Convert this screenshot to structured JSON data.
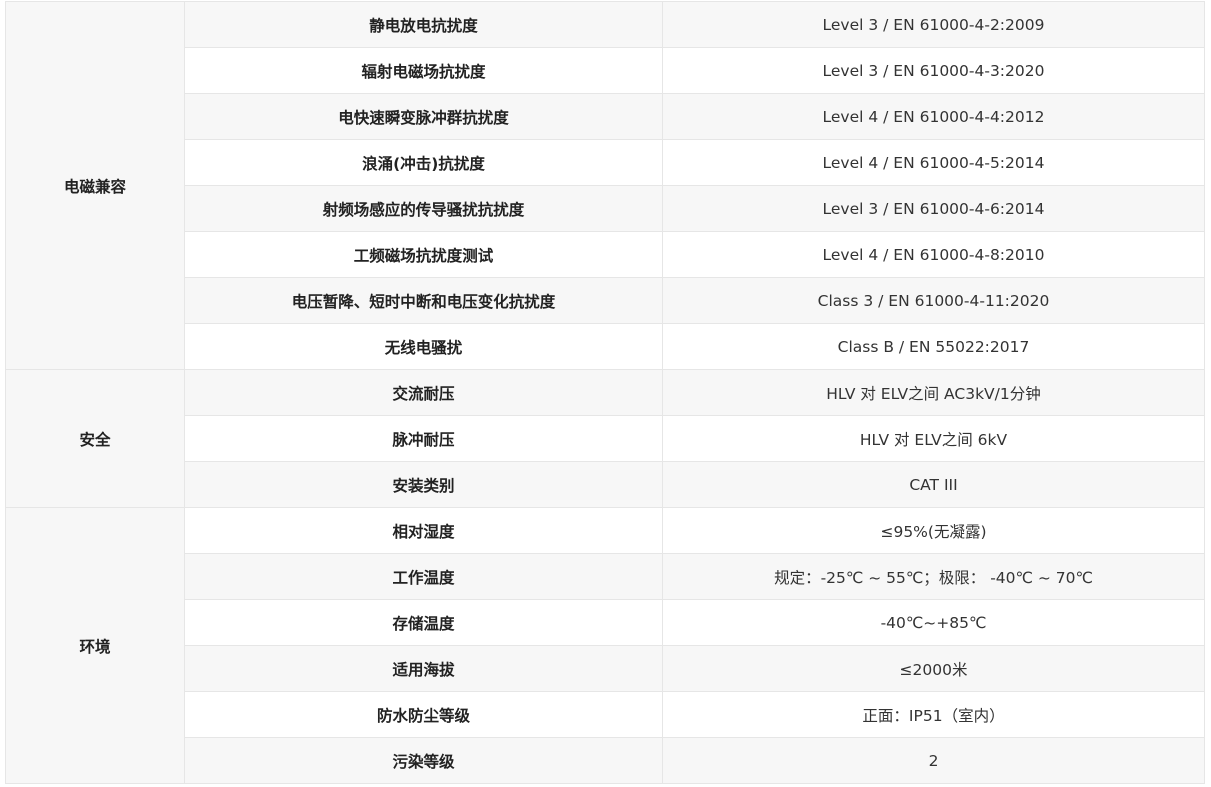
{
  "groups": [
    {
      "category": "电磁兼容",
      "rows": [
        {
          "name": "静电放电抗扰度",
          "value": "Level 3 / EN 61000-4-2:2009"
        },
        {
          "name": "辐射电磁场抗扰度",
          "value": "Level 3 / EN 61000-4-3:2020"
        },
        {
          "name": "电快速瞬变脉冲群抗扰度",
          "value": "Level 4 / EN 61000-4-4:2012"
        },
        {
          "name": "浪涌(冲击)抗扰度",
          "value": "Level 4 / EN 61000-4-5:2014"
        },
        {
          "name": "射频场感应的传导骚扰抗扰度",
          "value": "Level 3 / EN 61000-4-6:2014"
        },
        {
          "name": "工频磁场抗扰度测试",
          "value": "Level 4 / EN 61000-4-8:2010"
        },
        {
          "name": "电压暂降、短时中断和电压变化抗扰度",
          "value": "Class 3 / EN 61000-4-11:2020"
        },
        {
          "name": "无线电骚扰",
          "value": "Class B / EN 55022:2017"
        }
      ]
    },
    {
      "category": "安全",
      "rows": [
        {
          "name": "交流耐压",
          "value": "HLV 对 ELV之间 AC3kV/1分钟"
        },
        {
          "name": "脉冲耐压",
          "value": "HLV 对 ELV之间 6kV"
        },
        {
          "name": "安装类别",
          "value": "CAT III"
        }
      ]
    },
    {
      "category": "环境",
      "rows": [
        {
          "name": "相对湿度",
          "value": "≤95%(无凝露)"
        },
        {
          "name": "工作温度",
          "value": "规定：-25℃ ~ 55℃；极限： -40℃ ~ 70℃"
        },
        {
          "name": "存储温度",
          "value": "-40℃~+85℃"
        },
        {
          "name": "适用海拔",
          "value": "≤2000米"
        },
        {
          "name": "防水防尘等级",
          "value": "正面：IP51（室内）"
        },
        {
          "name": "污染等级",
          "value": "2"
        }
      ]
    }
  ]
}
